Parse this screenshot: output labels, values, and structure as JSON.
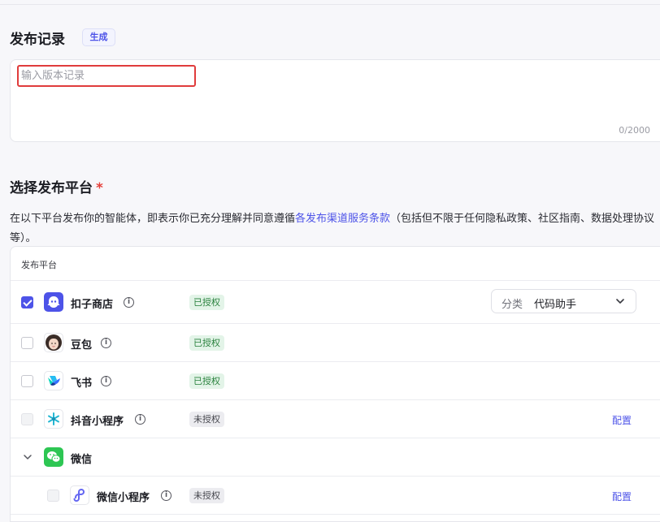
{
  "release": {
    "title": "发布记录",
    "generate_label": "生成",
    "placeholder": "输入版本记录",
    "value": "",
    "counter": "0/2000"
  },
  "platform": {
    "title": "选择发布平台",
    "required_mark": "*",
    "desc_before": "在以下平台发布你的智能体，即表示你已充分理解并同意遵循",
    "desc_link": "各发布渠道服务条款",
    "desc_after": "（包括但不限于任何隐私政策、社区指南、数据处理协议等）。",
    "table_header": "发布平台",
    "rows": [
      {
        "name": "扣子商店",
        "status": "已授权",
        "checked": true
      },
      {
        "name": "豆包",
        "status": "已授权",
        "checked": false
      },
      {
        "name": "飞书",
        "status": "已授权",
        "checked": false
      },
      {
        "name": "抖音小程序",
        "status": "未授权",
        "action": "配置",
        "checked": false
      },
      {
        "name": "微信"
      },
      {
        "name": "微信小程序",
        "status": "未授权",
        "action": "配置",
        "checked": false
      }
    ],
    "category": {
      "label": "分类",
      "value": "代码助手"
    },
    "info_glyph": "i"
  },
  "colors": {
    "accent": "#4d53e8",
    "authorized_bg": "#e3f4e8",
    "authorized_text": "#28813c",
    "error_border": "#e03c3c"
  },
  "icons": {
    "coze": "coze-store-icon",
    "doubao": "doubao-avatar-icon",
    "feishu": "feishu-icon",
    "douyin": "douyin-miniprogram-icon",
    "wechat": "wechat-icon",
    "wechat_mini": "wechat-miniprogram-icon",
    "info": "info-icon",
    "chevron": "chevron-down-icon"
  }
}
